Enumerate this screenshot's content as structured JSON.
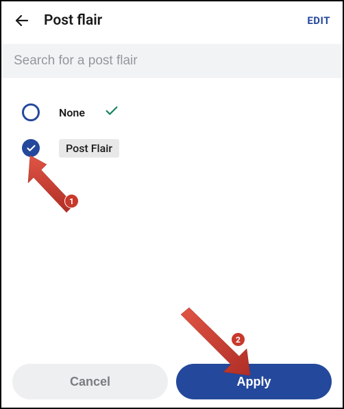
{
  "header": {
    "title": "Post flair",
    "edit_label": "EDIT"
  },
  "search": {
    "placeholder": "Search for a post flair"
  },
  "flairs": [
    {
      "label": "None",
      "selected": false,
      "show_check": true
    },
    {
      "label": "Post Flair",
      "selected": true,
      "show_check": false
    }
  ],
  "footer": {
    "cancel_label": "Cancel",
    "apply_label": "Apply"
  },
  "annotations": {
    "badge1": "1",
    "badge2": "2"
  },
  "colors": {
    "accent": "#24489b",
    "annotation": "#c8392b"
  }
}
